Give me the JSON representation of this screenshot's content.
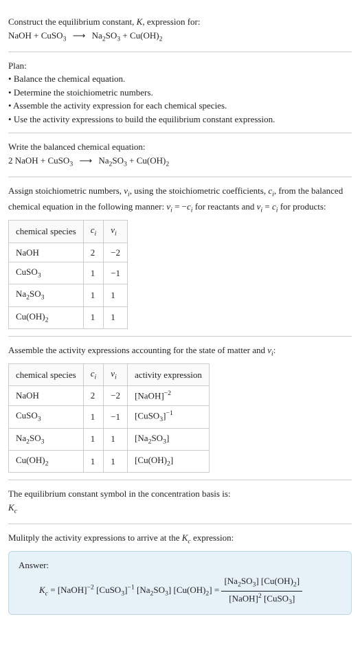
{
  "header": {
    "line1": "Construct the equilibrium constant, ",
    "ksym": "K",
    "line1b": ", expression for:",
    "equation_lhs1": "NaOH + CuSO",
    "equation_lhs1_sub": "3",
    "arrow": "⟶",
    "equation_rhs1a": "Na",
    "equation_rhs1a_sub": "2",
    "equation_rhs1b": "SO",
    "equation_rhs1b_sub": "3",
    "equation_rhs1c": " + Cu(OH)",
    "equation_rhs1c_sub": "2"
  },
  "plan": {
    "title": "Plan:",
    "items": [
      "Balance the chemical equation.",
      "Determine the stoichiometric numbers.",
      "Assemble the activity expression for each chemical species.",
      "Use the activity expressions to build the equilibrium constant expression."
    ]
  },
  "balanced": {
    "title": "Write the balanced chemical equation:",
    "lhs_pre": "2 NaOH + CuSO",
    "lhs_sub": "3",
    "arrow": "⟶",
    "rhs1a": "Na",
    "rhs1a_sub": "2",
    "rhs1b": "SO",
    "rhs1b_sub": "3",
    "rhs1c": " + Cu(OH)",
    "rhs1c_sub": "2"
  },
  "stoich": {
    "intro1": "Assign stoichiometric numbers, ",
    "nu": "ν",
    "sub_i": "i",
    "intro2": ", using the stoichiometric coefficients, ",
    "c": "c",
    "intro3": ", from the balanced chemical equation in the following manner: ",
    "rel1": "ν",
    "rel1b": " = −",
    "rel1c": "c",
    "rel1d": " for reactants and ",
    "rel2": "ν",
    "rel2b": " = ",
    "rel2c": "c",
    "rel2d": " for products:",
    "table": {
      "h1": "chemical species",
      "h2_sym": "c",
      "h3_sym": "ν",
      "rows": [
        {
          "sp_a": "NaOH",
          "sp_sub": "",
          "c": "2",
          "n": "−2"
        },
        {
          "sp_a": "CuSO",
          "sp_sub": "3",
          "c": "1",
          "n": "−1"
        },
        {
          "sp_a": "Na",
          "sp_mid": "2",
          "sp_b": "SO",
          "sp_sub": "3",
          "c": "1",
          "n": "1"
        },
        {
          "sp_a": "Cu(OH)",
          "sp_sub": "2",
          "c": "1",
          "n": "1"
        }
      ]
    }
  },
  "activity": {
    "intro": "Assemble the activity expressions accounting for the state of matter and ",
    "nu": "ν",
    "sub_i": "i",
    "colon": ":",
    "table": {
      "h1": "chemical species",
      "h2_sym": "c",
      "h3_sym": "ν",
      "h4": "activity expression",
      "rows": [
        {
          "sp_a": "NaOH",
          "sp_sub": "",
          "c": "2",
          "n": "−2",
          "act_a": "[NaOH]",
          "act_sup": "−2"
        },
        {
          "sp_a": "CuSO",
          "sp_sub": "3",
          "c": "1",
          "n": "−1",
          "act_a": "[CuSO",
          "act_mid_sub": "3",
          "act_b": "]",
          "act_sup": "−1"
        },
        {
          "sp_a": "Na",
          "sp_mid": "2",
          "sp_b": "SO",
          "sp_sub": "3",
          "c": "1",
          "n": "1",
          "act_a": "[Na",
          "act_mid_sub": "2",
          "act_b": "SO",
          "act_mid_sub2": "3",
          "act_c": "]",
          "act_sup": ""
        },
        {
          "sp_a": "Cu(OH)",
          "sp_sub": "2",
          "c": "1",
          "n": "1",
          "act_a": "[Cu(OH)",
          "act_mid_sub": "2",
          "act_b": "]",
          "act_sup": ""
        }
      ]
    }
  },
  "basis": {
    "line1": "The equilibrium constant symbol in the concentration basis is:",
    "ksym": "K",
    "ksub": "c"
  },
  "multiply": {
    "line": "Mulitply the activity expressions to arrive at the ",
    "ksym": "K",
    "ksub": "c",
    "line2": " expression:"
  },
  "answer": {
    "label": "Answer:",
    "kc_k": "K",
    "kc_sub": "c",
    "eq": " = ",
    "lhs1": "[NaOH]",
    "lhs1_sup": "−2",
    "lhs2": " [CuSO",
    "lhs2_sub": "3",
    "lhs2b": "]",
    "lhs2_sup": "−1",
    "lhs3": " [Na",
    "lhs3_sub": "2",
    "lhs3b": "SO",
    "lhs3b_sub": "3",
    "lhs3c": "] [Cu(OH)",
    "lhs3c_sub": "2",
    "lhs3d": "] = ",
    "num1": "[Na",
    "num1_sub": "2",
    "num1b": "SO",
    "num1b_sub": "3",
    "num1c": "] [Cu(OH)",
    "num1c_sub": "2",
    "num1d": "]",
    "den1": "[NaOH]",
    "den1_sup": "2",
    "den2": " [CuSO",
    "den2_sub": "3",
    "den2b": "]"
  }
}
